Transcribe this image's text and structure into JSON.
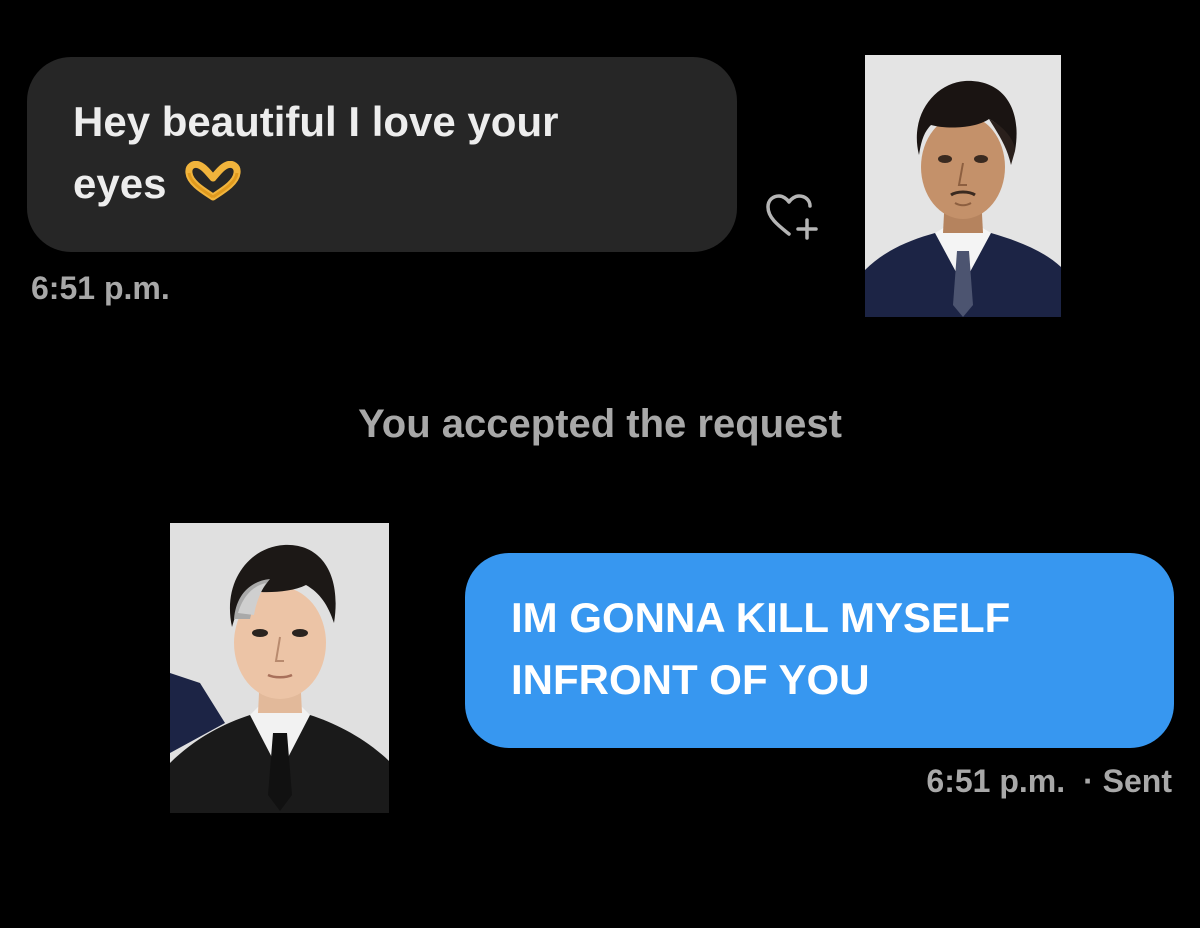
{
  "thread": {
    "incoming": {
      "line1": "Hey beautiful I love your",
      "line2": "eyes",
      "emoji": "heart-hands-emoji",
      "time": "6:51 p.m."
    },
    "system_message": "You accepted the request",
    "outgoing": {
      "line1": "IM GONNA KILL MYSELF",
      "line2": "INFRONT OF YOU",
      "time": "6:51 p.m.",
      "status": "· Sent"
    }
  },
  "icons": {
    "react": "heart-plus-icon"
  },
  "colors": {
    "background": "#000000",
    "incoming_bubble": "#262626",
    "outgoing_bubble": "#3797f0",
    "secondary_text": "#a8a8a8"
  }
}
